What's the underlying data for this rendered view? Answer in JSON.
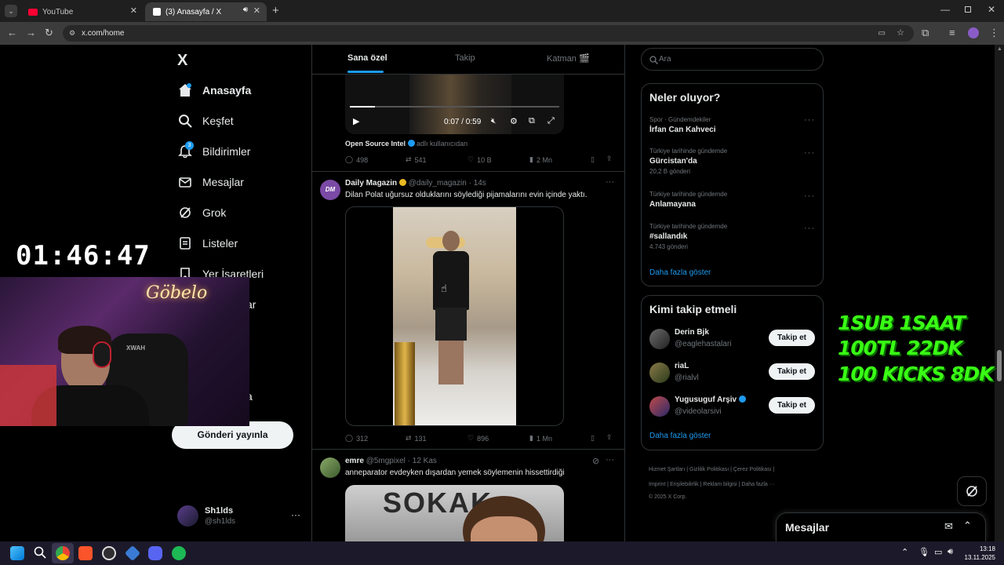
{
  "browser": {
    "tabs": [
      {
        "title": "YouTube",
        "active": false,
        "fav_color": "#ff0033"
      },
      {
        "title": "(3) Anasayfa / X",
        "active": true,
        "fav_color": "#ffffff"
      }
    ],
    "url": "x.com/home"
  },
  "sidebar": {
    "logo": "X",
    "items": [
      {
        "label": "Anasayfa",
        "icon": "home-icon"
      },
      {
        "label": "Keşfet",
        "icon": "search-icon"
      },
      {
        "label": "Bildirimler",
        "icon": "bell-icon",
        "badge": "3"
      },
      {
        "label": "Mesajlar",
        "icon": "mail-icon"
      },
      {
        "label": "Grok",
        "icon": "grok-icon"
      },
      {
        "label": "Listeler",
        "icon": "list-icon"
      },
      {
        "label": "Yer İşaretleri",
        "icon": "bookmark-icon"
      }
    ],
    "partial_item_1": "ar",
    "partial_item_2": "a",
    "post_button": "Gönderi yayınla",
    "account": {
      "name": "Sh1lds",
      "handle": "@sh1lds"
    }
  },
  "feed": {
    "tabs": [
      "Sana özel",
      "Takip",
      "Katman 🎬"
    ],
    "tweet1": {
      "video_time": "0:07 / 0:59",
      "source": "Open Source Intel",
      "source_suffix": "adlı kullanıcıdan",
      "replies": "498",
      "retweets": "541",
      "likes": "10 B",
      "views": "2 Mn"
    },
    "tweet2": {
      "avatar_text": "DM",
      "name": "Daily Magazin",
      "handle": "@daily_magazin",
      "time": "14s",
      "text": "Dilan Polat uğursuz olduklarını söylediği pijamalarını evin içinde yaktı.",
      "replies": "312",
      "retweets": "131",
      "likes": "896",
      "views": "1 Mn"
    },
    "tweet3": {
      "name": "emre",
      "handle": "@5mgpixel",
      "time": "12 Kas",
      "text": "anneparator evdeyken dışardan yemek söylemenin hissettirdiği",
      "image_sign": "SOKAK"
    }
  },
  "right": {
    "search_placeholder": "Ara",
    "trending_title": "Neler oluyor?",
    "trends": [
      {
        "context": "Spor · Gündemdekiler",
        "name": "İrfan Can Kahveci",
        "count": ""
      },
      {
        "context": "Türkiye tarihinde gündemde",
        "name": "Gürcistan'da",
        "count": "20,2 B gönderi"
      },
      {
        "context": "Türkiye tarihinde gündemde",
        "name": "Anlamayana",
        "count": ""
      },
      {
        "context": "Türkiye tarihinde gündemde",
        "name": "#sallandık",
        "count": "4.743 gönderi"
      }
    ],
    "show_more": "Daha fazla göster",
    "follow_title": "Kimi takip etmeli",
    "follow": [
      {
        "name": "Derin Bjk",
        "handle": "@eaglehastalari",
        "button": "Takip et",
        "verified": false
      },
      {
        "name": "riaL",
        "handle": "@rialvl",
        "button": "Takip et",
        "verified": false
      },
      {
        "name": "Yugusuguf Arşiv",
        "handle": "@videolarsivi",
        "button": "Takip et",
        "verified": true
      }
    ],
    "follow_more": "Daha fazla göster",
    "footer_1": [
      "Hizmet Şartları",
      "Gizlilik Politikası",
      "Çerez Politikası"
    ],
    "footer_2": [
      "Imprint",
      "Erişilebilirlik",
      "Reklam bilgisi",
      "Daha fazla ···"
    ],
    "copyright": "© 2025 X Corp.",
    "messages_dock": "Mesajlar"
  },
  "stream_overlay": {
    "timer": "01:46:47",
    "neon_sign": "Göbelo",
    "chair_brand": "XWAH",
    "lines": [
      "1SUB 1SAAT",
      "100TL 22DK",
      "100 KICKS 8DK"
    ]
  },
  "taskbar": {
    "time": "13:18",
    "date": "13.11.2025"
  }
}
